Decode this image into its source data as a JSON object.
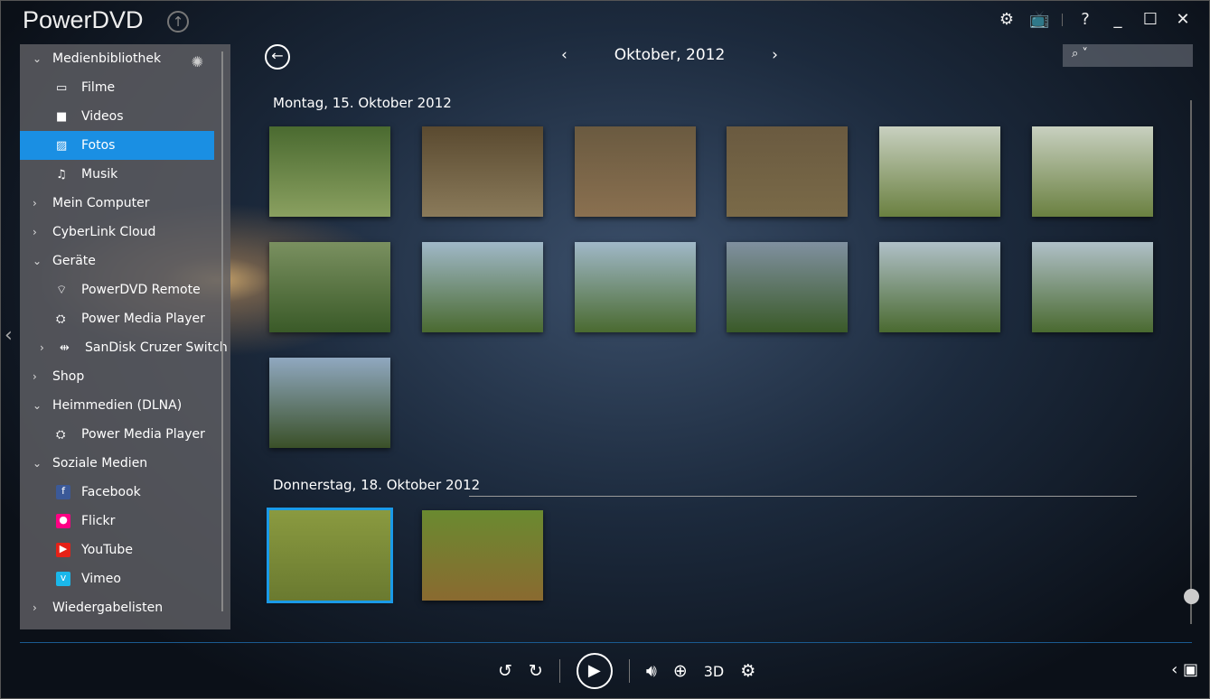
{
  "app": {
    "title": "PowerDVD"
  },
  "sidebar": {
    "items": [
      {
        "label": "Medienbibliothek",
        "level": 0,
        "expanded": true
      },
      {
        "label": "Filme",
        "level": 1,
        "icon": "film-icon"
      },
      {
        "label": "Videos",
        "level": 1,
        "icon": "video-camera-icon"
      },
      {
        "label": "Fotos",
        "level": 1,
        "icon": "photo-icon",
        "active": true
      },
      {
        "label": "Musik",
        "level": 1,
        "icon": "music-note-icon"
      },
      {
        "label": "Mein Computer",
        "level": 0,
        "expanded": false
      },
      {
        "label": "CyberLink Cloud",
        "level": 0,
        "expanded": false
      },
      {
        "label": "Geräte",
        "level": 0,
        "expanded": true
      },
      {
        "label": "PowerDVD Remote",
        "level": 1,
        "icon": "wifi-icon"
      },
      {
        "label": "Power Media Player",
        "level": 1,
        "icon": "media-player-icon"
      },
      {
        "label": "SanDisk Cruzer Switch",
        "level": 1,
        "icon": "usb-icon",
        "expandable": true
      },
      {
        "label": "Shop",
        "level": 0,
        "expanded": false
      },
      {
        "label": "Heimmedien (DLNA)",
        "level": 0,
        "expanded": true
      },
      {
        "label": "Power Media Player",
        "level": 1,
        "icon": "media-player-icon"
      },
      {
        "label": "Soziale Medien",
        "level": 0,
        "expanded": true
      },
      {
        "label": "Facebook",
        "level": 1,
        "icon": "facebook-icon",
        "color": "#3b5998"
      },
      {
        "label": "Flickr",
        "level": 1,
        "icon": "flickr-icon",
        "color": "#ff0084"
      },
      {
        "label": "YouTube",
        "level": 1,
        "icon": "youtube-icon",
        "color": "#e62117"
      },
      {
        "label": "Vimeo",
        "level": 1,
        "icon": "vimeo-icon",
        "color": "#1ab7ea"
      },
      {
        "label": "Wiedergabelisten",
        "level": 0,
        "expanded": false
      }
    ]
  },
  "nav": {
    "month": "Oktober, 2012"
  },
  "groups": [
    {
      "date": "Montag, 15. Oktober 2012",
      "photos": 13
    },
    {
      "date": "Donnerstag, 18. Oktober 2012",
      "photos": 2,
      "selected": 0
    }
  ],
  "controls": {
    "three_d": "3D"
  },
  "colors": {
    "accent": "#1a8fe3"
  }
}
